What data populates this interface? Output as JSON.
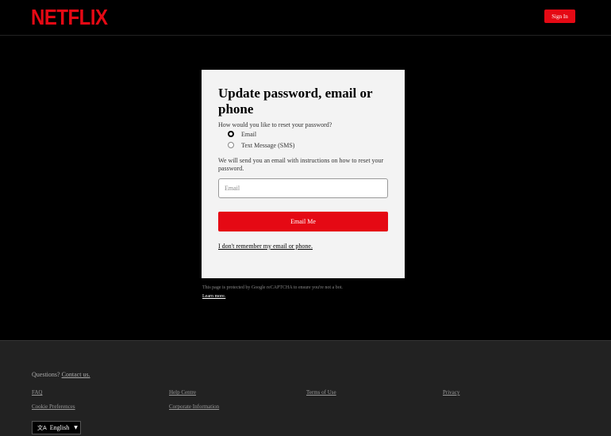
{
  "header": {
    "logo": "NETFLIX",
    "sign_in_label": "Sign In"
  },
  "card": {
    "title": "Update password, email or phone",
    "question": "How would you like to reset your password?",
    "options": [
      {
        "label": "Email",
        "selected": true
      },
      {
        "label": "Text Message (SMS)",
        "selected": false
      }
    ],
    "info": "We will send you an email with instructions on how to reset your password.",
    "email_placeholder": "Email",
    "email_value": "",
    "submit_label": "Email Me",
    "forgot_link": "I don't remember my email or phone."
  },
  "recaptcha": {
    "text": "This page is protected by Google reCAPTCHA to ensure you're not a bot.",
    "learn_more": "Learn more."
  },
  "footer": {
    "questions_prefix": "Questions?",
    "contact_link": "Contact us.",
    "links": {
      "faq": "FAQ",
      "help_centre": "Help Centre",
      "terms": "Terms of Use",
      "privacy": "Privacy",
      "cookies": "Cookie Preferences",
      "corporate": "Corporate Information"
    },
    "language": {
      "icon": "translate-icon",
      "selected": "English"
    }
  },
  "colors": {
    "brand_red": "#e50914",
    "background": "#000000",
    "card_bg": "#f3f3f3",
    "footer_bg": "#222222"
  }
}
